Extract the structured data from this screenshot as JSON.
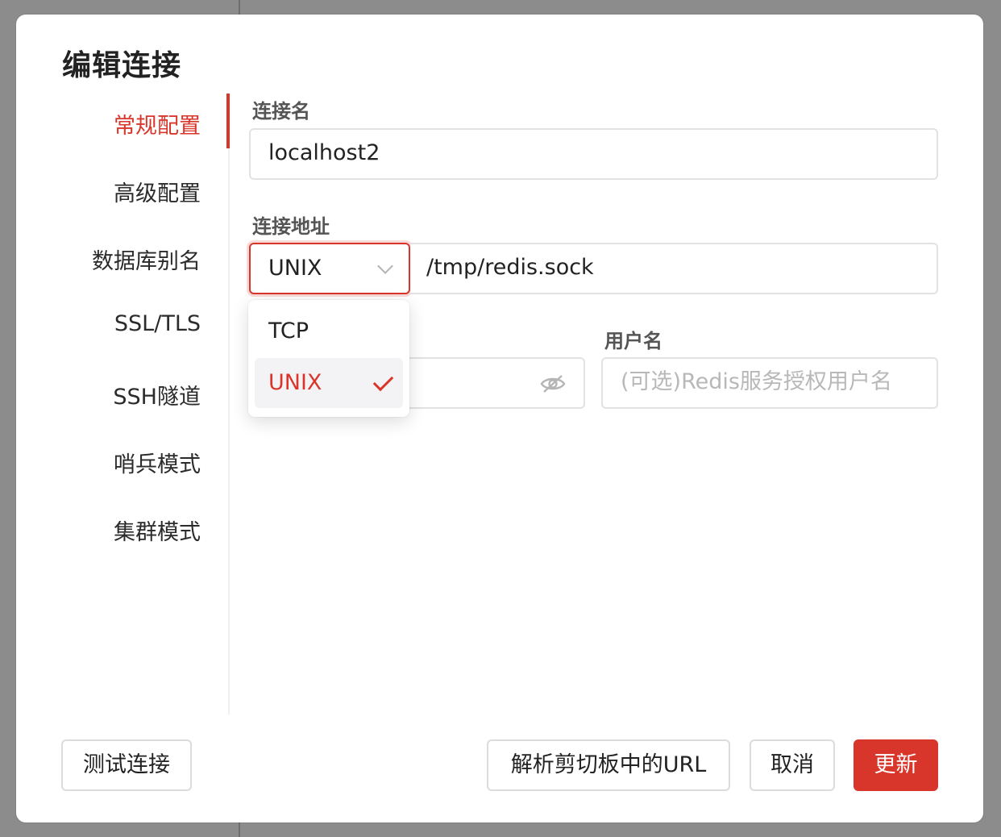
{
  "dialog": {
    "title": "编辑连接"
  },
  "sidebar": {
    "items": [
      {
        "label": "常规配置",
        "active": true
      },
      {
        "label": "高级配置",
        "active": false
      },
      {
        "label": "数据库别名",
        "active": false
      },
      {
        "label": "SSL/TLS",
        "active": false
      },
      {
        "label": "SSH隧道",
        "active": false
      },
      {
        "label": "哨兵模式",
        "active": false
      },
      {
        "label": "集群模式",
        "active": false
      }
    ]
  },
  "form": {
    "name_label": "连接名",
    "name_value": "localhost2",
    "address_label": "连接地址",
    "address_type_value": "UNIX",
    "address_value": "/tmp/redis.sock",
    "username_label": "用户名",
    "username_placeholder": "(可选)Redis服务授权用户名",
    "password_icon": "eye-slash-icon"
  },
  "dropdown": {
    "options": [
      {
        "label": "TCP",
        "selected": false
      },
      {
        "label": "UNIX",
        "selected": true
      }
    ]
  },
  "footer": {
    "test_label": "测试连接",
    "parse_url_label": "解析剪切板中的URL",
    "cancel_label": "取消",
    "update_label": "更新"
  },
  "colors": {
    "accent": "#d9362b"
  }
}
